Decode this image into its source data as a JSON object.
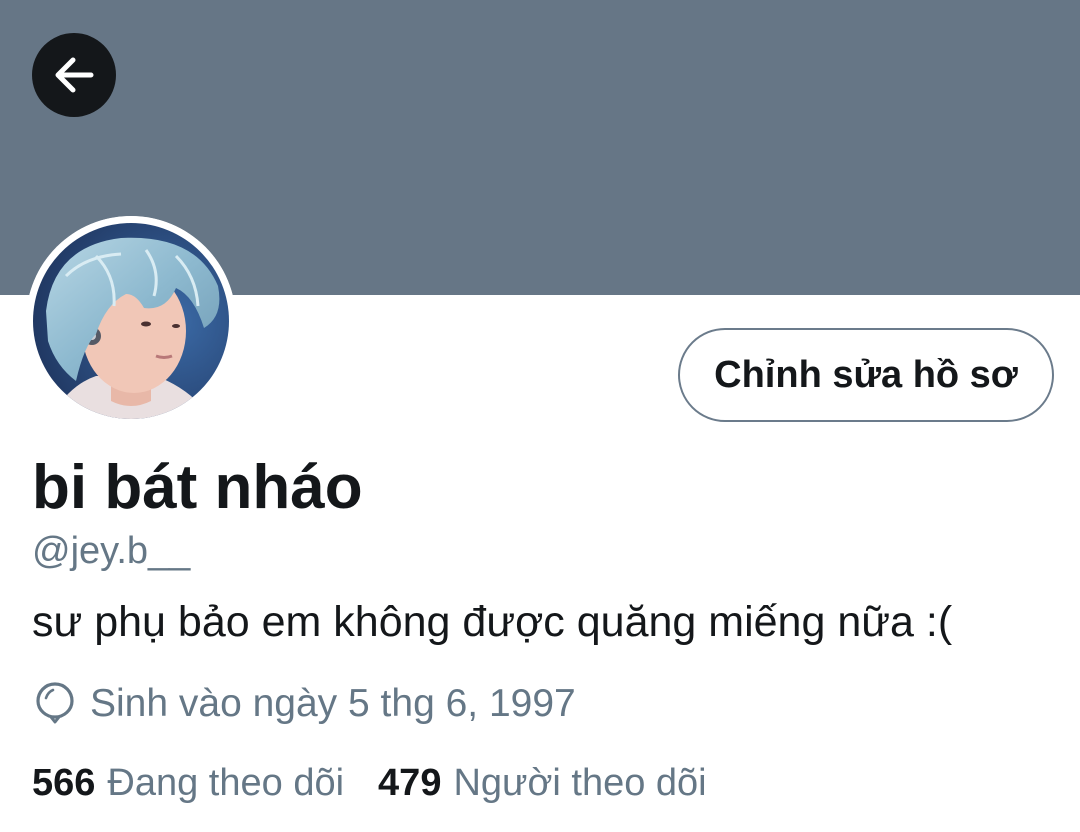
{
  "profile": {
    "display_name": "bi bát nháo",
    "handle": "@jey.b__",
    "bio": "sư phụ bảo em không được quăng miếng nữa :(",
    "birth_date": "Sinh vào ngày 5 thg 6, 1997"
  },
  "actions": {
    "edit_profile_label": "Chỉnh sửa hồ sơ"
  },
  "stats": {
    "following_count": "566",
    "following_label": "Đang theo dõi",
    "followers_count": "479",
    "followers_label": "Người theo dõi"
  },
  "icons": {
    "back": "arrow-left-icon",
    "birthday": "balloon-icon"
  },
  "colors": {
    "banner": "#667686",
    "primary_text": "#14171a",
    "secondary_text": "#657786",
    "back_button_bg": "#14171a"
  }
}
